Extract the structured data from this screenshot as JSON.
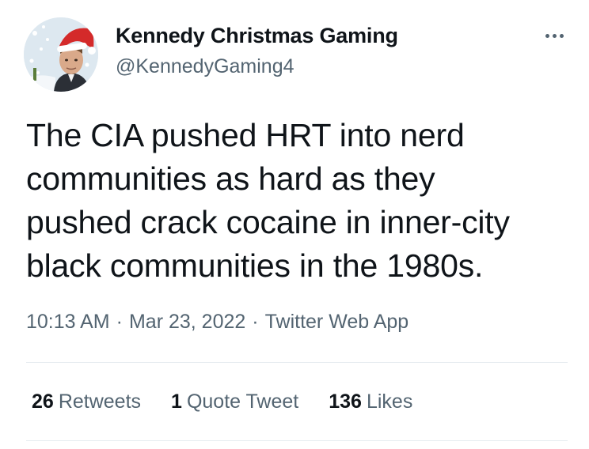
{
  "author": {
    "display_name": "Kennedy Christmas Gaming",
    "handle": "@KennedyGaming4",
    "avatar_icon": "santa-hat-portrait"
  },
  "tweet": {
    "text_lines": [
      "The CIA pushed HRT into nerd",
      "communities as hard as they",
      "pushed crack cocaine in inner-city",
      "black communities in the 1980s."
    ],
    "time": "10:13 AM",
    "separator": "·",
    "date": "Mar 23, 2022",
    "source": "Twitter Web App"
  },
  "stats": {
    "retweets": {
      "count": "26",
      "label": "Retweets"
    },
    "quote_tweets": {
      "count": "1",
      "label": "Quote Tweet"
    },
    "likes": {
      "count": "136",
      "label": "Likes"
    }
  },
  "colors": {
    "text_primary": "#0f1419",
    "text_secondary": "#536471",
    "divider": "#e6ecf0",
    "hat_red": "#d42a2a"
  }
}
